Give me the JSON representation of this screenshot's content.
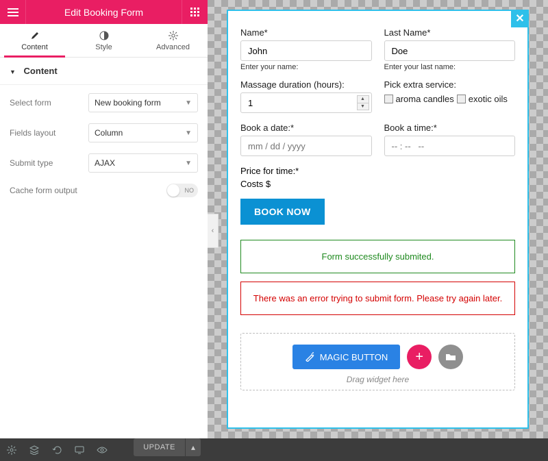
{
  "header": {
    "title": "Edit Booking Form"
  },
  "tabs": {
    "content": "Content",
    "style": "Style",
    "advanced": "Advanced"
  },
  "section": {
    "title": "Content"
  },
  "controls": {
    "select_form": {
      "label": "Select form",
      "value": "New booking form"
    },
    "fields_layout": {
      "label": "Fields layout",
      "value": "Column"
    },
    "submit_type": {
      "label": "Submit type",
      "value": "AJAX"
    },
    "cache": {
      "label": "Cache form output",
      "value": "NO"
    }
  },
  "bottom": {
    "update": "UPDATE"
  },
  "preview": {
    "name": {
      "label": "Name*",
      "value": "John",
      "hint": "Enter your name:"
    },
    "last": {
      "label": "Last Name*",
      "value": "Doe",
      "hint": "Enter your last name:"
    },
    "duration": {
      "label": "Massage duration (hours):",
      "value": "1"
    },
    "extras": {
      "label": "Pick extra service:",
      "opt1": "aroma candles",
      "opt2": "exotic oils"
    },
    "date": {
      "label": "Book a date:*",
      "placeholder": "mm / dd / yyyy"
    },
    "time": {
      "label": "Book a time:*",
      "placeholder": "-- : --   --"
    },
    "price": {
      "label": "Price for time:*",
      "value": "Costs $"
    },
    "submit": "BOOK NOW",
    "success": "Form successfully submited.",
    "error": "There was an error trying to submit form. Please try again later.",
    "magic": "MAGIC BUTTON",
    "drag": "Drag widget here"
  }
}
